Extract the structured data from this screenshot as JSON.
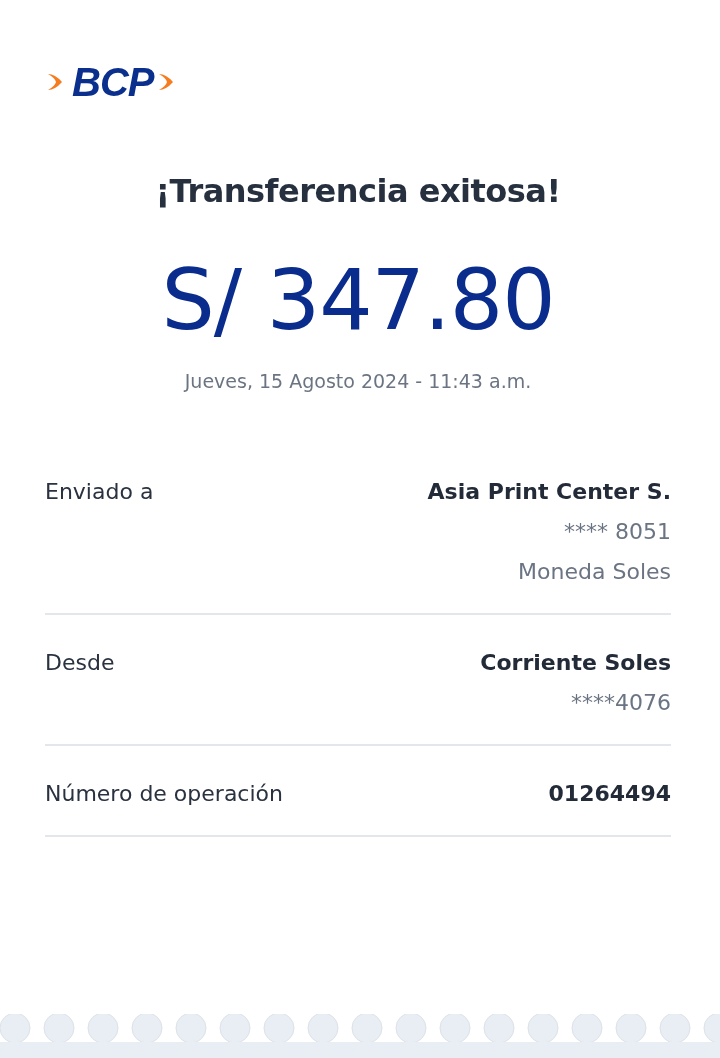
{
  "logo": {
    "text": "BCP"
  },
  "title": "¡Transferencia exitosa!",
  "amount": "S/ 347.80",
  "date": "Jueves, 15 Agosto 2024 - 11:43 a.m.",
  "rows": [
    {
      "label": "Enviado a",
      "values": [
        {
          "text": "Asia Print Center S.",
          "kind": "strong"
        },
        {
          "text": "**** 8051",
          "kind": "muted"
        },
        {
          "text": "Moneda Soles",
          "kind": "muted"
        }
      ]
    },
    {
      "label": "Desde",
      "values": [
        {
          "text": "Corriente Soles",
          "kind": "strong"
        },
        {
          "text": "****4076",
          "kind": "muted"
        }
      ]
    },
    {
      "label": "Número de operación",
      "values": [
        {
          "text": "01264494",
          "kind": "strong"
        }
      ]
    }
  ]
}
